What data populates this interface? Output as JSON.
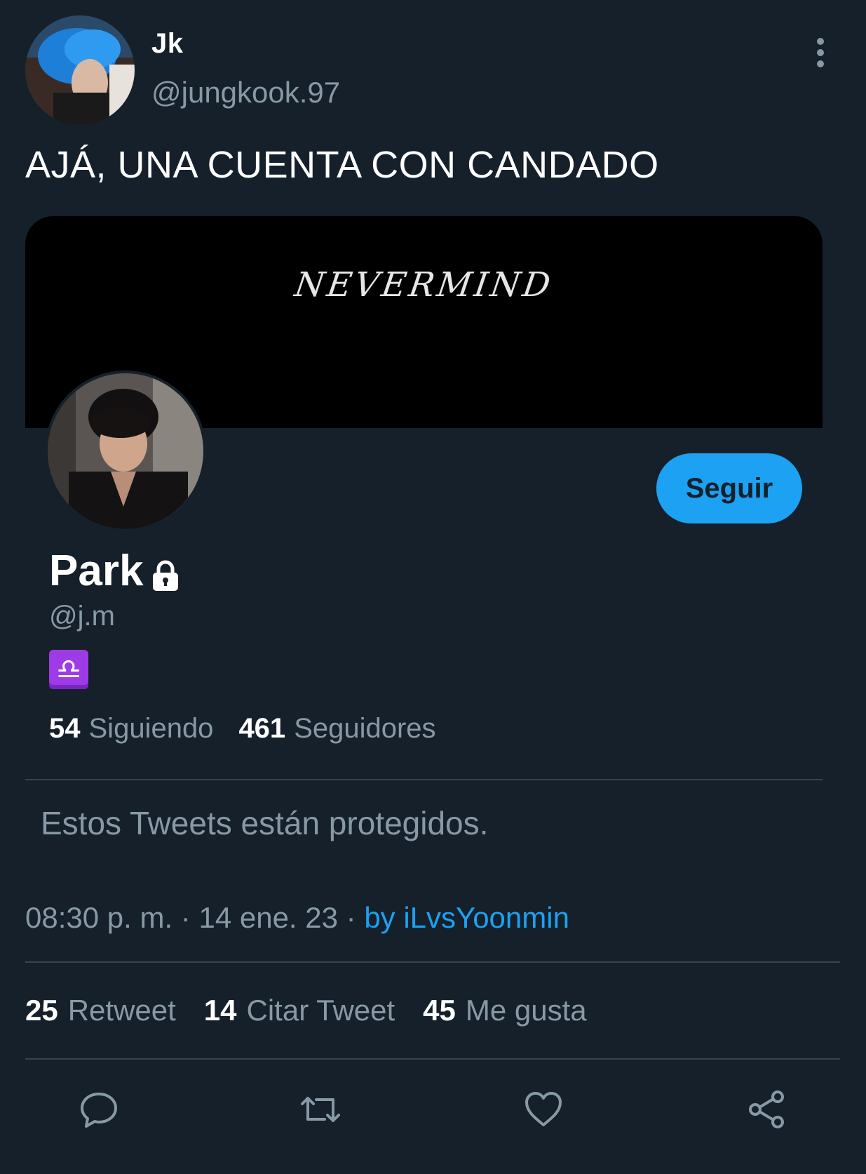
{
  "author": {
    "name": "Jk",
    "handle": "@jungkook.97"
  },
  "tweet": {
    "text": "AJÁ, UNA CUENTA CON CANDADO"
  },
  "profile_card": {
    "banner_text": "NEVERMIND",
    "name": "Park",
    "handle": "@j.m",
    "badge": "♎",
    "follow_label": "Seguir",
    "following_count": "54",
    "following_label": "Siguiendo",
    "followers_count": "461",
    "followers_label": "Seguidores",
    "protected_message": "Estos Tweets están protegidos."
  },
  "meta": {
    "time": "08:30 p. m.",
    "separator": "·",
    "date": "14 ene. 23",
    "via": "by iLvsYoonmin"
  },
  "engagement": {
    "retweets_count": "25",
    "retweets_label": "Retweet",
    "quotes_count": "14",
    "quotes_label": "Citar Tweet",
    "likes_count": "45",
    "likes_label": "Me gusta"
  },
  "actions": [
    {
      "icon": "reply-icon"
    },
    {
      "icon": "retweet-icon"
    },
    {
      "icon": "heart-icon"
    },
    {
      "icon": "share-icon"
    }
  ],
  "colors": {
    "background": "#15202b",
    "accent": "#1da1f2",
    "muted": "#8899a6",
    "divider": "#38444d",
    "badge": "#9d3be6"
  }
}
